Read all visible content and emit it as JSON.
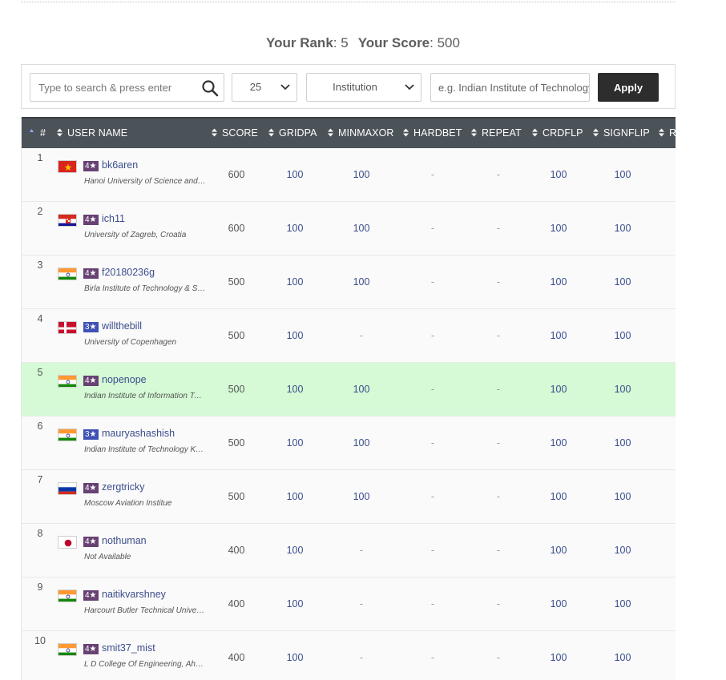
{
  "rank_summary": {
    "rank_label": "Your Rank",
    "rank_value": "5",
    "score_label": "Your Score",
    "score_value": "500"
  },
  "filters": {
    "search_placeholder": "Type to search & press enter",
    "per_page": "25",
    "filter_type": "Institution",
    "institution_placeholder": "e.g. Indian Institute of Technology",
    "apply_label": "Apply"
  },
  "table": {
    "columns": [
      "#",
      "USER NAME",
      "SCORE",
      "GRIDPA",
      "MINMAXOR",
      "HARDBET",
      "REPEAT",
      "CRDFLP",
      "SIGNFLIP",
      "R"
    ],
    "rows": [
      {
        "rank": "1",
        "flag": "vn",
        "stars": "4★",
        "username": "bk6aren",
        "institution": "Hanoi University of Science and Technology",
        "score": "600",
        "gridpa": "100",
        "minmaxor": "100",
        "hardbet": "-",
        "repeat": "-",
        "crdflp": "100",
        "signflip": "100"
      },
      {
        "rank": "2",
        "flag": "hr",
        "stars": "4★",
        "username": "ich11",
        "institution": "University of Zagreb, Croatia",
        "score": "600",
        "gridpa": "100",
        "minmaxor": "100",
        "hardbet": "-",
        "repeat": "-",
        "crdflp": "100",
        "signflip": "100"
      },
      {
        "rank": "3",
        "flag": "in",
        "stars": "4★",
        "username": "f20180236g",
        "institution": "Birla Institute of Technology & Science",
        "score": "500",
        "gridpa": "100",
        "minmaxor": "100",
        "hardbet": "-",
        "repeat": "-",
        "crdflp": "100",
        "signflip": "100"
      },
      {
        "rank": "4",
        "flag": "dk",
        "stars": "3★",
        "username": "willthebill",
        "institution": "University of Copenhagen",
        "score": "500",
        "gridpa": "100",
        "minmaxor": "-",
        "hardbet": "-",
        "repeat": "-",
        "crdflp": "100",
        "signflip": "100"
      },
      {
        "rank": "5",
        "flag": "in",
        "stars": "4★",
        "username": "nopenope",
        "institution": "Indian Institute of Information Technology",
        "score": "500",
        "gridpa": "100",
        "minmaxor": "100",
        "hardbet": "-",
        "repeat": "-",
        "crdflp": "100",
        "signflip": "100",
        "is_me": true
      },
      {
        "rank": "6",
        "flag": "in",
        "stars": "3★",
        "username": "mauryashashish",
        "institution": "Indian Institute of Technology Kanpur",
        "score": "500",
        "gridpa": "100",
        "minmaxor": "100",
        "hardbet": "-",
        "repeat": "-",
        "crdflp": "100",
        "signflip": "100"
      },
      {
        "rank": "7",
        "flag": "ru",
        "stars": "4★",
        "username": "zergtricky",
        "institution": "Moscow Aviation Institue",
        "score": "500",
        "gridpa": "100",
        "minmaxor": "100",
        "hardbet": "-",
        "repeat": "-",
        "crdflp": "100",
        "signflip": "100"
      },
      {
        "rank": "8",
        "flag": "jp",
        "stars": "4★",
        "username": "nothuman",
        "institution": "Not Available",
        "score": "400",
        "gridpa": "100",
        "minmaxor": "-",
        "hardbet": "-",
        "repeat": "-",
        "crdflp": "100",
        "signflip": "100"
      },
      {
        "rank": "9",
        "flag": "in",
        "stars": "4★",
        "username": "naitikvarshney",
        "institution": "Harcourt Butler Technical University",
        "score": "400",
        "gridpa": "100",
        "minmaxor": "-",
        "hardbet": "-",
        "repeat": "-",
        "crdflp": "100",
        "signflip": "100"
      },
      {
        "rank": "10",
        "flag": "in",
        "stars": "4★",
        "username": "smit37_mist",
        "institution": "L D College Of Engineering, Ahmedabad",
        "score": "400",
        "gridpa": "100",
        "minmaxor": "-",
        "hardbet": "-",
        "repeat": "-",
        "crdflp": "100",
        "signflip": "100"
      }
    ]
  },
  "colors": {
    "header_bg": "#4b5258",
    "apply_bg": "#2d2d2d",
    "highlight_row": "#d5fad5",
    "link": "#3b4d8c",
    "star4": "#684273",
    "star3": "#3f51b5"
  }
}
